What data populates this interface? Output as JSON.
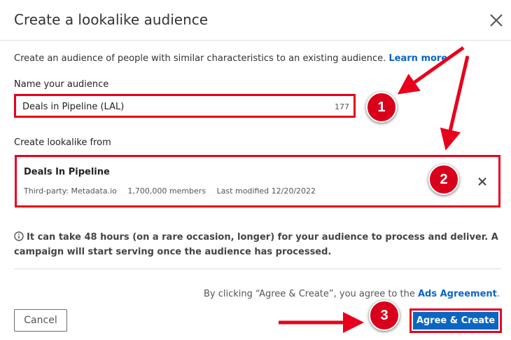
{
  "dialog": {
    "title": "Create a lookalike audience",
    "close_icon": "close-icon"
  },
  "intro": {
    "text": "Create an audience of people with similar characteristics to an existing audience.",
    "link": "Learn more"
  },
  "name_field": {
    "label": "Name your audience",
    "value": "Deals in Pipeline (LAL)",
    "char_count": "177"
  },
  "source": {
    "label": "Create lookalike from",
    "title": "Deals In Pipeline",
    "type": "Third-party: Metadata.io",
    "members": "1,700,000 members",
    "modified": "Last modified 12/20/2022",
    "remove_icon": "close-icon"
  },
  "info": {
    "icon": "info-icon",
    "text": "It can take 48 hours (on a rare occasion, longer) for your audience to process and deliver. A campaign will start serving once the audience has processed."
  },
  "footer": {
    "agreement_text": "By clicking “Agree & Create”, you agree to the",
    "agreement_link": "Ads Agreement",
    "agreement_end": ".",
    "cancel_label": "Cancel",
    "create_label": "Agree & Create"
  },
  "annotations": {
    "step1": "1",
    "step2": "2",
    "step3": "3",
    "color": "#e8001c"
  },
  "colors": {
    "accent": "#0a66c2",
    "highlight": "#e8001c"
  }
}
